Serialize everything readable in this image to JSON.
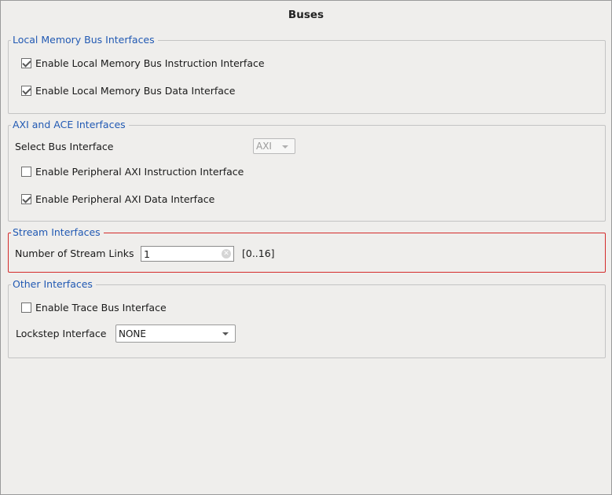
{
  "title": "Buses",
  "local_memory": {
    "legend": "Local Memory Bus Interfaces",
    "instruction": {
      "label": "Enable Local Memory Bus Instruction Interface",
      "checked": true
    },
    "data": {
      "label": "Enable Local Memory Bus Data Interface",
      "checked": true
    }
  },
  "axi": {
    "legend": "AXI and ACE Interfaces",
    "select_label": "Select Bus Interface",
    "select_value": "AXI",
    "peripheral_instruction": {
      "label": "Enable Peripheral AXI Instruction Interface",
      "checked": false
    },
    "peripheral_data": {
      "label": "Enable Peripheral AXI Data Interface",
      "checked": true
    }
  },
  "stream": {
    "legend": "Stream Interfaces",
    "links_label": "Number of Stream Links",
    "links_value": "1",
    "range": "[0..16]",
    "highlight_color": "#d42b2b"
  },
  "other": {
    "legend": "Other Interfaces",
    "trace": {
      "label": "Enable Trace Bus Interface",
      "checked": false
    },
    "lockstep_label": "Lockstep Interface",
    "lockstep_value": "NONE"
  },
  "colors": {
    "legend": "#2159b3",
    "background": "#efeeec"
  },
  "icons": {
    "clear": "clear-icon",
    "dropdown": "chevron-down-icon"
  }
}
